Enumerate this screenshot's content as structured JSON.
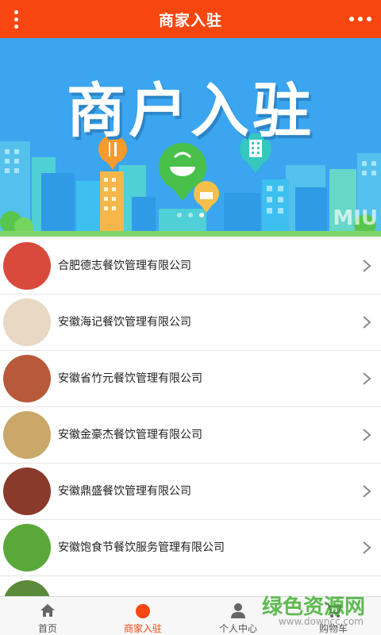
{
  "header": {
    "title": "商家入驻"
  },
  "banner": {
    "title": "商户入驻",
    "watermark": "MIU",
    "page_count": 3,
    "active_page": 3
  },
  "merchants": [
    {
      "name": "合肥德志餐饮管理有限公司",
      "thumb_color": "#d94a3d"
    },
    {
      "name": "安徽海记餐饮管理有限公司",
      "thumb_color": "#c87a4a"
    },
    {
      "name": "安徽省竹元餐饮管理有限公司",
      "thumb_color": "#b85a3a"
    },
    {
      "name": "安徽金豪杰餐饮管理有限公司",
      "thumb_color": "#c9a86a"
    },
    {
      "name": "安徽鼎盛餐饮管理有限公司",
      "thumb_color": "#8a3a2a"
    },
    {
      "name": "安徽饱食节餐饮服务管理有限公司",
      "thumb_color": "#5aa83a"
    },
    {
      "name": "",
      "thumb_color": "#5b8a3a"
    }
  ],
  "tabs": [
    {
      "label": "首页",
      "icon": "home-icon"
    },
    {
      "label": "商家入驻",
      "icon": "dot-icon",
      "active": true
    },
    {
      "label": "个人中心",
      "icon": "user-icon"
    },
    {
      "label": "购物车",
      "icon": "cart-icon"
    }
  ],
  "watermark": {
    "line1": "绿色资源网",
    "line2": "www.downcc.com"
  },
  "colors": {
    "brand": "#f7460f",
    "banner_bg": "#3ba5f0"
  }
}
